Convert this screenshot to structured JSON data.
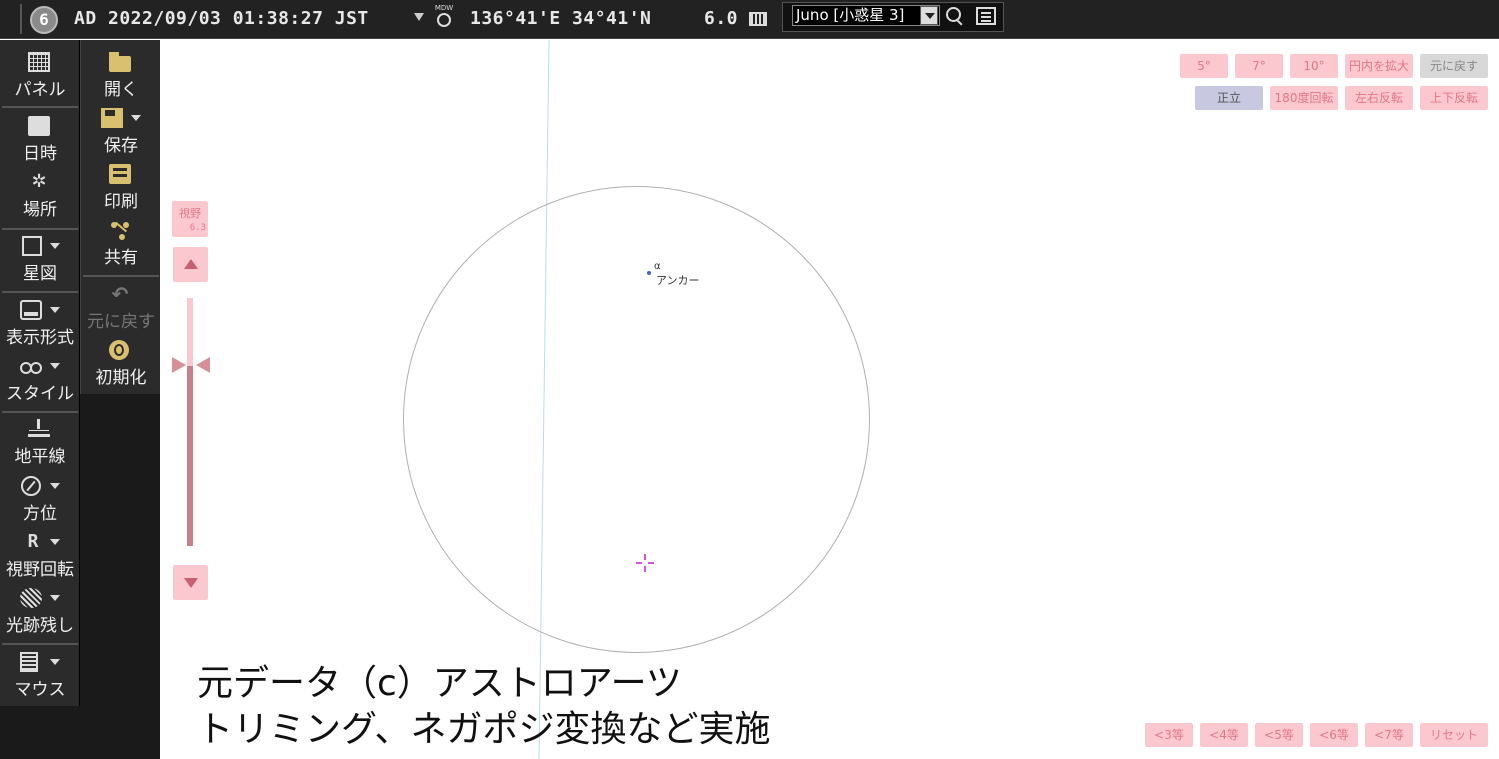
{
  "topbar": {
    "logo": "6",
    "datetime": "AD 2022/09/03 01:38:27 JST",
    "mdw_label": "MDW",
    "location": "136°41'E 34°41'N",
    "magnitude": "6.0",
    "target": "Juno [小惑星 3]"
  },
  "sidebar": {
    "col1": [
      {
        "label": "パネル",
        "icon": "grid-icon"
      },
      {
        "label": "日時",
        "icon": "clock-icon"
      },
      {
        "label": "場所",
        "icon": "location-icon"
      },
      {
        "label": "星図",
        "icon": "square-icon"
      },
      {
        "label": "表示形式",
        "icon": "monitor-icon"
      },
      {
        "label": "スタイル",
        "icon": "binoculars-icon"
      },
      {
        "label": "地平線",
        "icon": "horizon-icon"
      },
      {
        "label": "方位",
        "icon": "compass-icon"
      },
      {
        "label": "視野回転",
        "icon": "rotate-icon"
      },
      {
        "label": "光跡残し",
        "icon": "trail-icon"
      },
      {
        "label": "マウス",
        "icon": "mouse-icon"
      }
    ],
    "col2": [
      {
        "label": "開く",
        "icon": "folder-icon"
      },
      {
        "label": "保存",
        "icon": "save-icon"
      },
      {
        "label": "印刷",
        "icon": "print-icon"
      },
      {
        "label": "共有",
        "icon": "share-icon"
      },
      {
        "label": "元に戻す",
        "icon": "undo-icon"
      },
      {
        "label": "初期化",
        "icon": "reset-icon"
      }
    ]
  },
  "view_buttons": {
    "row1": [
      "5°",
      "7°",
      "10°",
      "円内を拡大",
      "元に戻す"
    ],
    "row2": [
      "正立",
      "180度回転",
      "左右反転",
      "上下反転"
    ]
  },
  "fov": {
    "label": "視野",
    "value": "6.3",
    "slider_level": 0.3
  },
  "star": {
    "greek": "α",
    "name": "アンカー"
  },
  "caption": {
    "line1": "元データ（c）アストロアーツ",
    "line2": "トリミング、ネガポジ変換など実施"
  },
  "magnitude_buttons": [
    "<3等",
    "<4等",
    "<5等",
    "<6等",
    "<7等",
    "リセット"
  ],
  "colors": {
    "button_pink": "#fcc8d0",
    "button_text": "#e07888",
    "panel_dark": "#2b2b2b",
    "crosshair": "#e050e0"
  }
}
